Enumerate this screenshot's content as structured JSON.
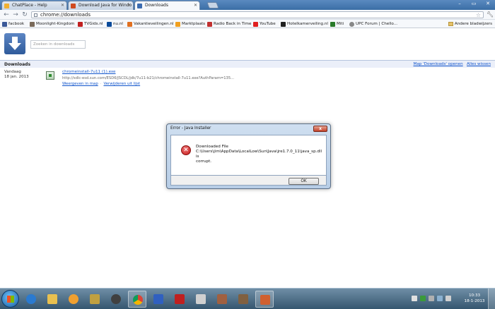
{
  "window": {
    "tabs": [
      {
        "label": "ChatPlace - Help",
        "icon_color": "#f0b030"
      },
      {
        "label": "Download Java for Windo",
        "icon_color": "#d04a20"
      },
      {
        "label": "Downloads",
        "icon_color": "#3b6bb0"
      }
    ],
    "address": "chrome://downloads"
  },
  "bookmarks": [
    {
      "label": "facbook",
      "icon_color": "#3b5998"
    },
    {
      "label": "Moonlight-Kingdom",
      "icon_color": "#7a6a5a"
    },
    {
      "label": "TVGids.nl",
      "icon_color": "#c02020"
    },
    {
      "label": "nu.nl",
      "icon_color": "#0a4a9a"
    },
    {
      "label": "Vakantieveilingen.nl",
      "icon_color": "#e07020"
    },
    {
      "label": "Marktplaats",
      "icon_color": "#f0a020"
    },
    {
      "label": "Radio Back in Time",
      "icon_color": "#c03030"
    },
    {
      "label": "YouTube",
      "icon_color": "#e02020"
    },
    {
      "label": "Hotelkamerveiling.nl",
      "icon_color": "#202020"
    },
    {
      "label": "Miti",
      "icon_color": "#2a7a2a"
    },
    {
      "label": "UPC Forum | Chello...",
      "icon_color": "#888888"
    }
  ],
  "other_bookmarks": "Andere bladwijzers",
  "downloads": {
    "search_placeholder": "Zoeken in downloads",
    "header": "Downloads",
    "open_folder_link": "Map 'Downloads' openen",
    "clear_all_link": "Alles wissen",
    "day_label": "Vandaag",
    "day_date": "18 jan. 2013",
    "item": {
      "file_name": "chromeinstall-7u11 (1).exe",
      "url": "http://sdlc-esd.sun.com/ESD6/JSCDL/jdk/7u11-b21/chromeinstall-7u11.exe?AuthParam=135...",
      "show_in_folder": "Weergeven in map",
      "remove": "Verwijderen uit lijst"
    }
  },
  "dialog": {
    "title": "Error - Java Installer",
    "message_line1": "Downloaded File",
    "message_line2": "C:\\Users\\jim\\AppData\\LocalLow\\Sun\\Java\\jre1.7.0_11\\java_sp.dll is",
    "message_line3": "corrupt.",
    "ok_label": "OK",
    "close_label": "x"
  },
  "taskbar": {
    "apps": [
      {
        "name": "internet-explorer",
        "color": "#2a7ad0"
      },
      {
        "name": "explorer",
        "color": "#e8c050"
      },
      {
        "name": "media-player",
        "color": "#f0a030"
      },
      {
        "name": "winamp",
        "color": "#c0a040"
      },
      {
        "name": "steam",
        "color": "#404040"
      },
      {
        "name": "chrome",
        "color": "#4caf50"
      },
      {
        "name": "paint",
        "color": "#3060c0"
      },
      {
        "name": "acrobat",
        "color": "#c02020"
      },
      {
        "name": "wolf",
        "color": "#d0d0d0"
      },
      {
        "name": "game",
        "color": "#a06040"
      },
      {
        "name": "game2",
        "color": "#806040"
      },
      {
        "name": "java",
        "color": "#d06030"
      }
    ],
    "clock_time": "10:33",
    "clock_date": "18-1-2013"
  }
}
